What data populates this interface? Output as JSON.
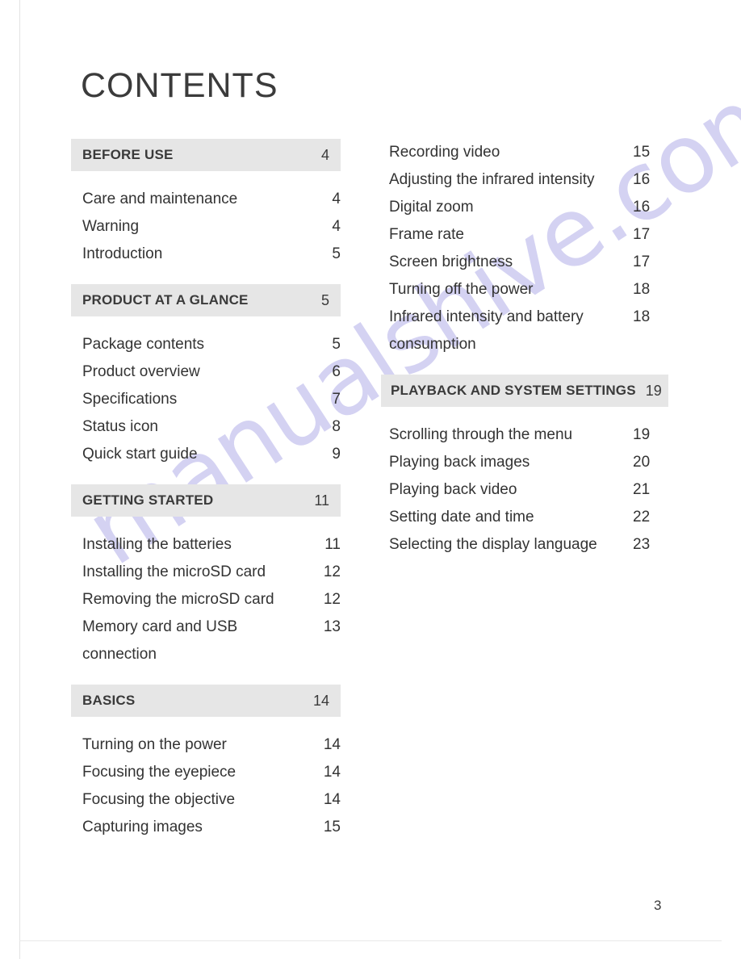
{
  "page": {
    "title": "CONTENTS",
    "folio": "3",
    "watermark": "manualshive.com",
    "accent_grey": "#e6e6e6",
    "text_color": "#333333",
    "watermark_color": "#c8c6ef"
  },
  "left_column": {
    "sections": [
      {
        "header": {
          "label": "BEFORE USE",
          "page": "4"
        },
        "entries": [
          {
            "title": "Care and maintenance",
            "page": "4"
          },
          {
            "title": "Warning",
            "page": "4"
          },
          {
            "title": "Introduction",
            "page": "5"
          }
        ]
      },
      {
        "header": {
          "label": "PRODUCT AT A GLANCE",
          "page": "5"
        },
        "entries": [
          {
            "title": "Package contents",
            "page": "5"
          },
          {
            "title": "Product overview",
            "page": "6"
          },
          {
            "title": "Specifications",
            "page": "7"
          },
          {
            "title": "Status icon",
            "page": "8"
          },
          {
            "title": "Quick start guide",
            "page": "9"
          }
        ]
      },
      {
        "header": {
          "label": "GETTING STARTED",
          "page": "11"
        },
        "entries": [
          {
            "title": "Installing the batteries",
            "page": "11"
          },
          {
            "title": "Installing the microSD card",
            "page": "12"
          },
          {
            "title": "Removing the microSD card",
            "page": "12"
          },
          {
            "title": "Memory card and USB connection",
            "page": "13"
          }
        ]
      },
      {
        "header": {
          "label": "BASICS",
          "page": "14"
        },
        "entries": [
          {
            "title": "Turning on the power",
            "page": "14"
          },
          {
            "title": "Focusing the eyepiece",
            "page": "14"
          },
          {
            "title": "Focusing the objective",
            "page": "14"
          },
          {
            "title": "Capturing images",
            "page": "15"
          }
        ]
      }
    ]
  },
  "right_column": {
    "continued_entries": [
      {
        "title": "Recording video",
        "page": "15"
      },
      {
        "title": "Adjusting the infrared intensity",
        "page": "16"
      },
      {
        "title": "Digital zoom",
        "page": "16"
      },
      {
        "title": "Frame rate",
        "page": "17"
      },
      {
        "title": "Screen brightness",
        "page": "17"
      },
      {
        "title": "Turning off the power",
        "page": "18"
      },
      {
        "title": "Infrared intensity and battery consumption",
        "page": "18"
      }
    ],
    "sections": [
      {
        "header": {
          "label": "PLAYBACK AND SYSTEM SETTINGS",
          "page": "19"
        },
        "entries": [
          {
            "title": "Scrolling through the menu",
            "page": "19"
          },
          {
            "title": "Playing back images",
            "page": "20"
          },
          {
            "title": "Playing back video",
            "page": "21"
          },
          {
            "title": "Setting date and time",
            "page": "22"
          },
          {
            "title": "Selecting the display language",
            "page": "23"
          }
        ]
      }
    ]
  }
}
